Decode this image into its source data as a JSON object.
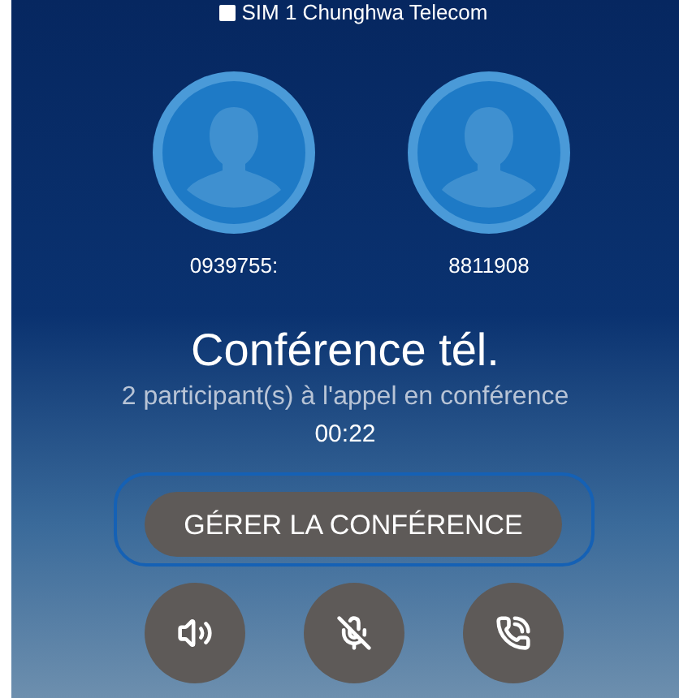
{
  "sim": {
    "label": "SIM 1 Chunghwa Telecom"
  },
  "participants": [
    {
      "number": "0939755:"
    },
    {
      "number": "8811908"
    }
  ],
  "call": {
    "title": "Conférence tél.",
    "subtitle": "2 participant(s) à l'appel en conférence",
    "timer": "00:22"
  },
  "manage_button": {
    "label": "GÉRER LA CONFÉRENCE"
  },
  "controls": [
    {
      "kind": "speaker"
    },
    {
      "kind": "mute"
    },
    {
      "kind": "hold"
    }
  ]
}
